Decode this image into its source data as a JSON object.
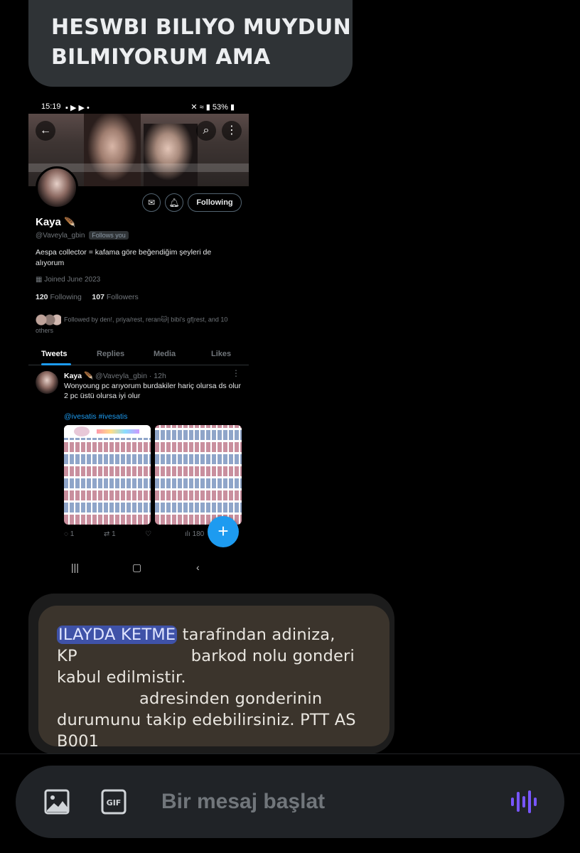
{
  "top_bubble": {
    "line1": "HESWBI BILIYO MUYDUN",
    "line2": "BILMIYORUM AMA"
  },
  "screenshot": {
    "status": {
      "time": "15:19",
      "battery": "53%"
    },
    "profile": {
      "name": "Kaya",
      "handle": "@Vaveyla_gbin",
      "follows_you": "Follows you",
      "bio": "Aespa collector = kafama göre beğendiğim şeyleri de alıyorum",
      "joined": "Joined June 2023",
      "following_count": "120",
      "following_label": "Following",
      "followers_count": "107",
      "followers_label": "Followers",
      "followed_by": "Followed by den!, priya/rest, reran🐱| bibi's gf|rest, and 10 others",
      "follow_button": "Following"
    },
    "tabs": [
      "Tweets",
      "Replies",
      "Media",
      "Likes"
    ],
    "tweet": {
      "name": "Kaya",
      "handle": "@Vaveyla_gbin",
      "time": "· 12h",
      "text": "Wonyoung pc arıyorum burdakiler hariç olursa ds olur 2 pc üstü olursa iyi olur",
      "tags": "@ivesatis #ivesatis",
      "replies": "1",
      "retweets": "1",
      "views": "180"
    }
  },
  "sms": {
    "highlight": "ILAYDA KETME",
    "line1_rest": " tarafindan adiniza,",
    "line2_a": "KP",
    "line2_b": "barkod nolu gonderi",
    "line3": "kabul edilmistir.",
    "line4": "adresinden gonderinin",
    "line5": "durumunu takip edebilirsiniz. PTT AS",
    "line6": "B001"
  },
  "composer": {
    "placeholder": "Bir mesaj başlat",
    "gif_label": "GIF"
  },
  "colors": {
    "accent": "#1d9bf0",
    "voice": "#7856ff",
    "highlight": "#3f52a8"
  }
}
